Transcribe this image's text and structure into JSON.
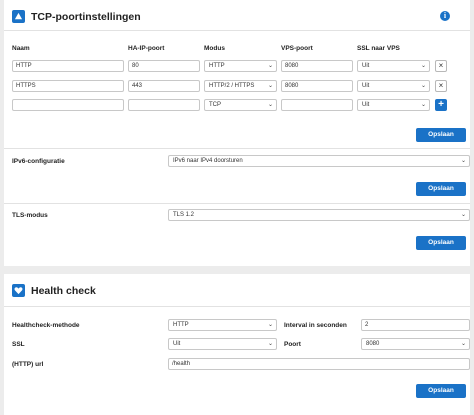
{
  "tcp": {
    "title": "TCP-poortinstellingen",
    "columns": [
      "Naam",
      "HA-IP-poort",
      "Modus",
      "VPS-poort",
      "SSL naar VPS"
    ],
    "rows": [
      {
        "name": "HTTP",
        "ha_port": "80",
        "mode": "HTTP",
        "vps_port": "8080",
        "ssl": "Uit"
      },
      {
        "name": "HTTPS",
        "ha_port": "443",
        "mode": "HTTP/2 / HTTPS",
        "vps_port": "8080",
        "ssl": "Uit"
      },
      {
        "name": "",
        "ha_port": "",
        "mode": "TCP",
        "vps_port": "",
        "ssl": "Uit"
      }
    ],
    "save_label": "Opslaan",
    "ipv6_label": "IPv6-configuratie",
    "ipv6_value": "IPv6 naar IPv4 doorsturen",
    "tls_label": "TLS-modus",
    "tls_value": "TLS 1.2"
  },
  "health": {
    "title": "Health check",
    "method_label": "Healthcheck-methode",
    "method_value": "HTTP",
    "interval_label": "Interval in seconden",
    "interval_value": "2",
    "ssl_label": "SSL",
    "ssl_value": "Uit",
    "port_label": "Poort",
    "port_value": "8080",
    "url_label": "(HTTP) url",
    "url_value": "/health",
    "save_label": "Opslaan"
  },
  "icons": {
    "tcp": "network-arrow-icon",
    "info": "info-icon",
    "health": "heart-icon",
    "delete": "close-icon",
    "add": "plus-icon",
    "dropdown": "chevron-down-icon"
  },
  "colors": {
    "accent": "#1a72c7",
    "background": "#ececec",
    "card": "#ffffff"
  }
}
